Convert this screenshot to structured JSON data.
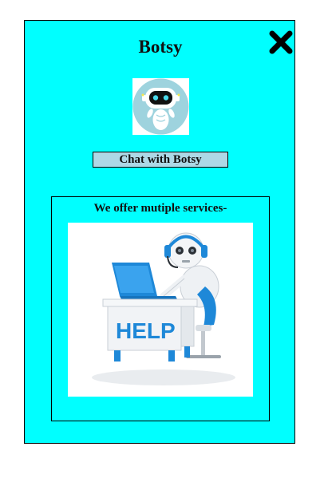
{
  "app": {
    "title": "Botsy"
  },
  "chat_button": {
    "label": "Chat with Botsy"
  },
  "services": {
    "heading": "We offer mutiple services-",
    "image_text": "HELP"
  },
  "icons": {
    "close": "close-icon",
    "avatar": "robot-avatar-icon"
  },
  "colors": {
    "panel_background": "#00ffff",
    "button_background": "#add8e6"
  }
}
